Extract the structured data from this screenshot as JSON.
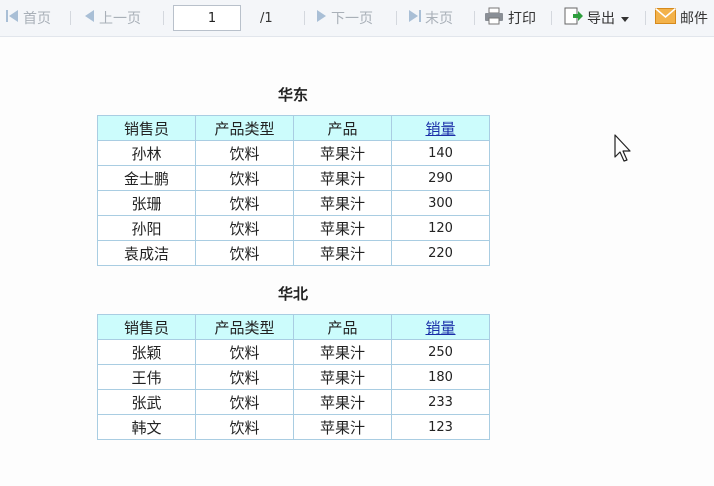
{
  "toolbar": {
    "first_label": "首页",
    "prev_label": "上一页",
    "page_value": "1",
    "page_total": "/1",
    "next_label": "下一页",
    "last_label": "末页",
    "print_label": "打印",
    "export_label": "导出",
    "mail_label": "邮件"
  },
  "columns": [
    "销售员",
    "产品类型",
    "产品",
    "销量"
  ],
  "sections": [
    {
      "title": "华东",
      "rows": [
        {
          "name": "孙林",
          "type": "饮料",
          "product": "苹果汁",
          "qty": "140"
        },
        {
          "name": "金士鹏",
          "type": "饮料",
          "product": "苹果汁",
          "qty": "290"
        },
        {
          "name": "张珊",
          "type": "饮料",
          "product": "苹果汁",
          "qty": "300"
        },
        {
          "name": "孙阳",
          "type": "饮料",
          "product": "苹果汁",
          "qty": "120"
        },
        {
          "name": "袁成洁",
          "type": "饮料",
          "product": "苹果汁",
          "qty": "220"
        }
      ]
    },
    {
      "title": "华北",
      "rows": [
        {
          "name": "张颖",
          "type": "饮料",
          "product": "苹果汁",
          "qty": "250"
        },
        {
          "name": "王伟",
          "type": "饮料",
          "product": "苹果汁",
          "qty": "180"
        },
        {
          "name": "张武",
          "type": "饮料",
          "product": "苹果汁",
          "qty": "233"
        },
        {
          "name": "韩文",
          "type": "饮料",
          "product": "苹果汁",
          "qty": "123"
        }
      ]
    }
  ],
  "colors": {
    "header_bg": "#ccfcfc",
    "border": "#a9cde2",
    "link": "#1a2fa8",
    "disabled_text": "#a9b0b8"
  }
}
